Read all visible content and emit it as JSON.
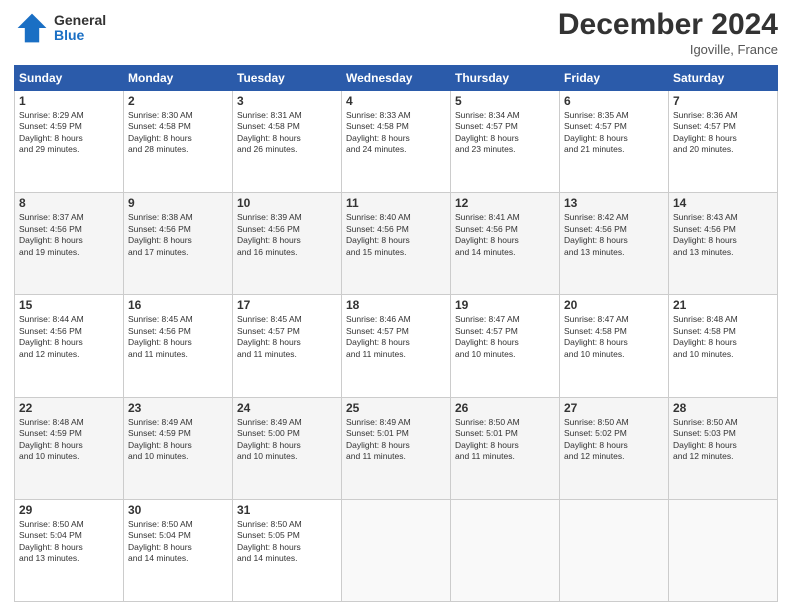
{
  "header": {
    "logo_general": "General",
    "logo_blue": "Blue",
    "month_title": "December 2024",
    "location": "Igoville, France"
  },
  "days_of_week": [
    "Sunday",
    "Monday",
    "Tuesday",
    "Wednesday",
    "Thursday",
    "Friday",
    "Saturday"
  ],
  "weeks": [
    [
      {
        "day": "1",
        "sunrise": "8:29 AM",
        "sunset": "4:59 PM",
        "daylight": "8 hours and 29 minutes."
      },
      {
        "day": "2",
        "sunrise": "8:30 AM",
        "sunset": "4:58 PM",
        "daylight": "8 hours and 28 minutes."
      },
      {
        "day": "3",
        "sunrise": "8:31 AM",
        "sunset": "4:58 PM",
        "daylight": "8 hours and 26 minutes."
      },
      {
        "day": "4",
        "sunrise": "8:33 AM",
        "sunset": "4:58 PM",
        "daylight": "8 hours and 24 minutes."
      },
      {
        "day": "5",
        "sunrise": "8:34 AM",
        "sunset": "4:57 PM",
        "daylight": "8 hours and 23 minutes."
      },
      {
        "day": "6",
        "sunrise": "8:35 AM",
        "sunset": "4:57 PM",
        "daylight": "8 hours and 21 minutes."
      },
      {
        "day": "7",
        "sunrise": "8:36 AM",
        "sunset": "4:57 PM",
        "daylight": "8 hours and 20 minutes."
      }
    ],
    [
      {
        "day": "8",
        "sunrise": "8:37 AM",
        "sunset": "4:56 PM",
        "daylight": "8 hours and 19 minutes."
      },
      {
        "day": "9",
        "sunrise": "8:38 AM",
        "sunset": "4:56 PM",
        "daylight": "8 hours and 17 minutes."
      },
      {
        "day": "10",
        "sunrise": "8:39 AM",
        "sunset": "4:56 PM",
        "daylight": "8 hours and 16 minutes."
      },
      {
        "day": "11",
        "sunrise": "8:40 AM",
        "sunset": "4:56 PM",
        "daylight": "8 hours and 15 minutes."
      },
      {
        "day": "12",
        "sunrise": "8:41 AM",
        "sunset": "4:56 PM",
        "daylight": "8 hours and 14 minutes."
      },
      {
        "day": "13",
        "sunrise": "8:42 AM",
        "sunset": "4:56 PM",
        "daylight": "8 hours and 13 minutes."
      },
      {
        "day": "14",
        "sunrise": "8:43 AM",
        "sunset": "4:56 PM",
        "daylight": "8 hours and 13 minutes."
      }
    ],
    [
      {
        "day": "15",
        "sunrise": "8:44 AM",
        "sunset": "4:56 PM",
        "daylight": "8 hours and 12 minutes."
      },
      {
        "day": "16",
        "sunrise": "8:45 AM",
        "sunset": "4:56 PM",
        "daylight": "8 hours and 11 minutes."
      },
      {
        "day": "17",
        "sunrise": "8:45 AM",
        "sunset": "4:57 PM",
        "daylight": "8 hours and 11 minutes."
      },
      {
        "day": "18",
        "sunrise": "8:46 AM",
        "sunset": "4:57 PM",
        "daylight": "8 hours and 11 minutes."
      },
      {
        "day": "19",
        "sunrise": "8:47 AM",
        "sunset": "4:57 PM",
        "daylight": "8 hours and 10 minutes."
      },
      {
        "day": "20",
        "sunrise": "8:47 AM",
        "sunset": "4:58 PM",
        "daylight": "8 hours and 10 minutes."
      },
      {
        "day": "21",
        "sunrise": "8:48 AM",
        "sunset": "4:58 PM",
        "daylight": "8 hours and 10 minutes."
      }
    ],
    [
      {
        "day": "22",
        "sunrise": "8:48 AM",
        "sunset": "4:59 PM",
        "daylight": "8 hours and 10 minutes."
      },
      {
        "day": "23",
        "sunrise": "8:49 AM",
        "sunset": "4:59 PM",
        "daylight": "8 hours and 10 minutes."
      },
      {
        "day": "24",
        "sunrise": "8:49 AM",
        "sunset": "5:00 PM",
        "daylight": "8 hours and 10 minutes."
      },
      {
        "day": "25",
        "sunrise": "8:49 AM",
        "sunset": "5:01 PM",
        "daylight": "8 hours and 11 minutes."
      },
      {
        "day": "26",
        "sunrise": "8:50 AM",
        "sunset": "5:01 PM",
        "daylight": "8 hours and 11 minutes."
      },
      {
        "day": "27",
        "sunrise": "8:50 AM",
        "sunset": "5:02 PM",
        "daylight": "8 hours and 12 minutes."
      },
      {
        "day": "28",
        "sunrise": "8:50 AM",
        "sunset": "5:03 PM",
        "daylight": "8 hours and 12 minutes."
      }
    ],
    [
      {
        "day": "29",
        "sunrise": "8:50 AM",
        "sunset": "5:04 PM",
        "daylight": "8 hours and 13 minutes."
      },
      {
        "day": "30",
        "sunrise": "8:50 AM",
        "sunset": "5:04 PM",
        "daylight": "8 hours and 14 minutes."
      },
      {
        "day": "31",
        "sunrise": "8:50 AM",
        "sunset": "5:05 PM",
        "daylight": "8 hours and 14 minutes."
      },
      null,
      null,
      null,
      null
    ]
  ],
  "labels": {
    "sunrise": "Sunrise:",
    "sunset": "Sunset:",
    "daylight": "Daylight:"
  }
}
